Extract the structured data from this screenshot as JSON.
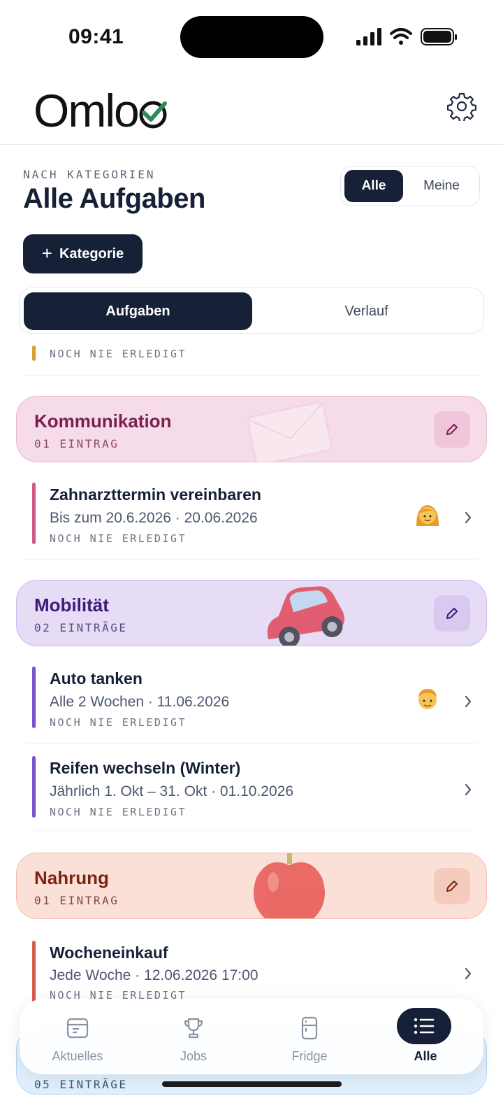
{
  "status_bar": {
    "time": "09:41"
  },
  "header": {
    "logo_text": "Omloo"
  },
  "page": {
    "eyebrow": "NACH KATEGORIEN",
    "title": "Alle Aufgaben",
    "filter": {
      "active": "Alle",
      "inactive": "Meine"
    },
    "add_category_label": "Kategorie",
    "tabs": {
      "active": "Aufgaben",
      "inactive": "Verlauf"
    }
  },
  "partial_row": {
    "status": "NOCH NIE ERLEDIGT",
    "color": "#d4a138"
  },
  "categories": [
    {
      "title": "Kommunikation",
      "count": "01 EINTRAG",
      "bg": "#f6dbe8",
      "border": "#eab8cf",
      "title_color": "#7a1f4d",
      "count_color": "#8a4a68",
      "edit_bg": "#f0c4d9",
      "tasks": [
        {
          "title": "Zahnarzttermin vereinbaren",
          "subtitle": "Bis zum 20.6.2026 · 20.06.2026",
          "status": "NOCH NIE ERLEDIGT",
          "color": "#d05a8a",
          "avatar": "woman"
        }
      ]
    },
    {
      "title": "Mobilität",
      "count": "02 EINTRÄGE",
      "bg": "#e6dcf6",
      "border": "#cbb9ec",
      "title_color": "#3d1c78",
      "count_color": "#5b4a7d",
      "edit_bg": "#d8c9f0",
      "tasks": [
        {
          "title": "Auto tanken",
          "subtitle": "Alle 2 Wochen · 11.06.2026",
          "status": "NOCH NIE ERLEDIGT",
          "color": "#7a52c9",
          "avatar": "man"
        },
        {
          "title": "Reifen wechseln (Winter)",
          "subtitle": "Jährlich 1. Okt – 31. Okt · 01.10.2026",
          "status": "NOCH NIE ERLEDIGT",
          "color": "#7a52c9"
        }
      ]
    },
    {
      "title": "Nahrung",
      "count": "01 EINTRAG",
      "bg": "#fbe0d8",
      "border": "#f2bfae",
      "title_color": "#7c2410",
      "count_color": "#7e4a3d",
      "edit_bg": "#f5cbbd",
      "tasks": [
        {
          "title": "Wocheneinkauf",
          "subtitle": "Jede Woche · 12.06.2026 17:00",
          "status": "NOCH NIE ERLEDIGT",
          "color": "#d6604a"
        }
      ]
    },
    {
      "count": "05 EINTRÄGE",
      "bg": "#dfeefa",
      "border": "#b9d7f0",
      "count_color": "#3d566e"
    }
  ],
  "nav": {
    "items": [
      {
        "label": "Aktuelles",
        "icon": "calendar-icon"
      },
      {
        "label": "Jobs",
        "icon": "trophy-icon"
      },
      {
        "label": "Fridge",
        "icon": "fridge-icon"
      },
      {
        "label": "Alle",
        "icon": "list-icon"
      }
    ],
    "active": "Alle"
  },
  "colors": {
    "primary": "#162036",
    "accent_check": "#2e8b57"
  }
}
